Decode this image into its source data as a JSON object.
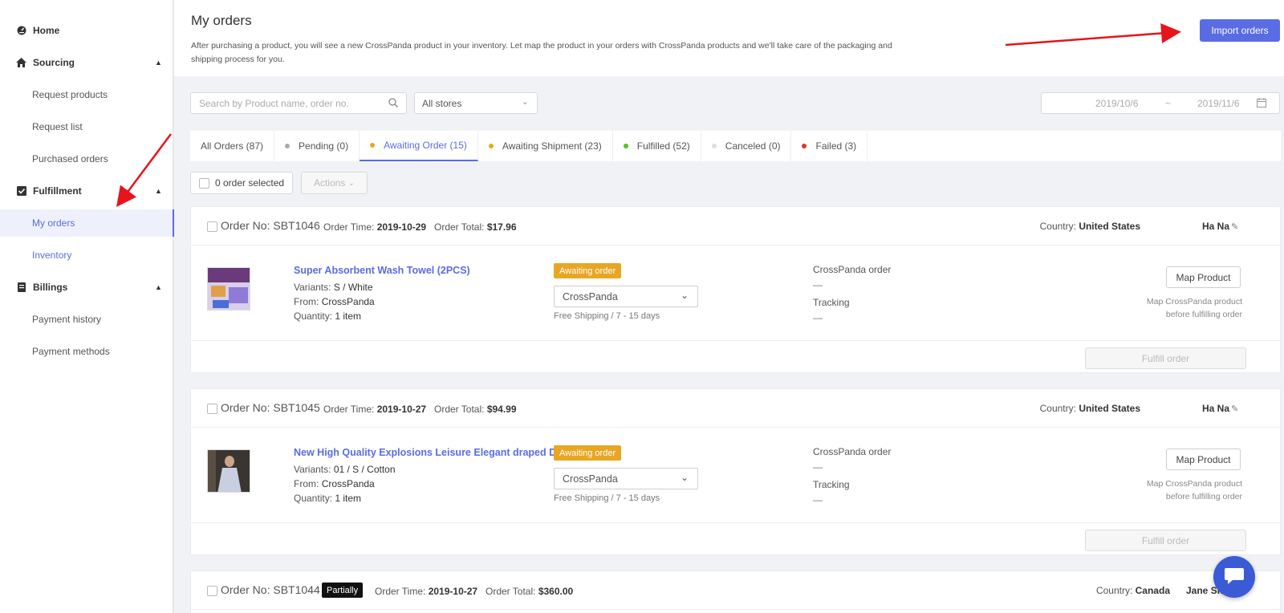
{
  "sidebar": {
    "home": {
      "label": "Home",
      "icon": "dashboard-icon"
    },
    "sourcing": {
      "label": "Sourcing",
      "icon": "home-icon",
      "items": [
        "Request products",
        "Request list",
        "Purchased orders"
      ]
    },
    "fulfillment": {
      "label": "Fulfillment",
      "icon": "checkbox-icon",
      "items": [
        "My orders",
        "Inventory"
      ],
      "active": "My orders"
    },
    "billings": {
      "label": "Billings",
      "icon": "billing-icon",
      "items": [
        "Payment history",
        "Payment methods"
      ]
    }
  },
  "header": {
    "title": "My orders",
    "description": "After purchasing a product, you will see a new CrossPanda product in your inventory. Let map the product in your orders with CrossPanda products and we'll take care of the packaging and shipping process for you.",
    "import_label": "Import orders"
  },
  "filters": {
    "search_placeholder": "Search by Product name, order no.",
    "store": "All stores",
    "date_from": "2019/10/6",
    "date_sep": "~",
    "date_to": "2019/11/6"
  },
  "tabs": [
    {
      "label": "All Orders (87)",
      "dot": ""
    },
    {
      "label": "Pending (0)",
      "dot": "#aaaaaa"
    },
    {
      "label": "Awaiting Order (15)",
      "dot": "#e8a623"
    },
    {
      "label": "Awaiting Shipment (23)",
      "dot": "#e8a623"
    },
    {
      "label": "Fulfilled (52)",
      "dot": "#52c41a"
    },
    {
      "label": "Canceled (0)",
      "dot": "#dddddd"
    },
    {
      "label": "Failed (3)",
      "dot": "#e03131"
    }
  ],
  "active_tab": "Awaiting Order (15)",
  "bulk": {
    "selected": "0 order selected",
    "actions": "Actions"
  },
  "labels": {
    "order_no": "Order No:",
    "order_time": "Order Time:",
    "order_total": "Order Total:",
    "country": "Country:",
    "variants": "Variants:",
    "from": "From:",
    "quantity": "Quantity:",
    "crosspanda_order": "CrossPanda order",
    "tracking": "Tracking",
    "dash": "—",
    "map_product": "Map Product",
    "map_note_1": "Map CrossPanda product",
    "map_note_2": "before fulfilling order",
    "fulfill": "Fulfill order"
  },
  "orders": [
    {
      "no": "SBT1046",
      "time": "2019-10-29",
      "total": "$17.96",
      "country": "United States",
      "customer": "Ha Na",
      "product": "Super Absorbent Wash Towel (2PCS)",
      "variants": "S / White",
      "from": "CrossPanda",
      "quantity": "1 item",
      "status": "Awaiting order",
      "supplier": "CrossPanda",
      "shipping": "Free Shipping / 7 - 15 days"
    },
    {
      "no": "SBT1045",
      "time": "2019-10-27",
      "total": "$94.99",
      "country": "United States",
      "customer": "Ha Na",
      "product": "New High Quality Explosions Leisure Elegant draped D...",
      "variants": "01 / S / Cotton",
      "from": "CrossPanda",
      "quantity": "1 item",
      "status": "Awaiting order",
      "supplier": "CrossPanda",
      "shipping": "Free Shipping / 7 - 15 days"
    },
    {
      "no": "SBT1044",
      "badge": "Partially",
      "time": "2019-10-27",
      "total": "$360.00",
      "country": "Canada",
      "customer": "Jane Smith"
    }
  ],
  "colors": {
    "accent": "#5a6ce4",
    "awaiting": "#e8a623",
    "arrow": "#e8141c"
  }
}
